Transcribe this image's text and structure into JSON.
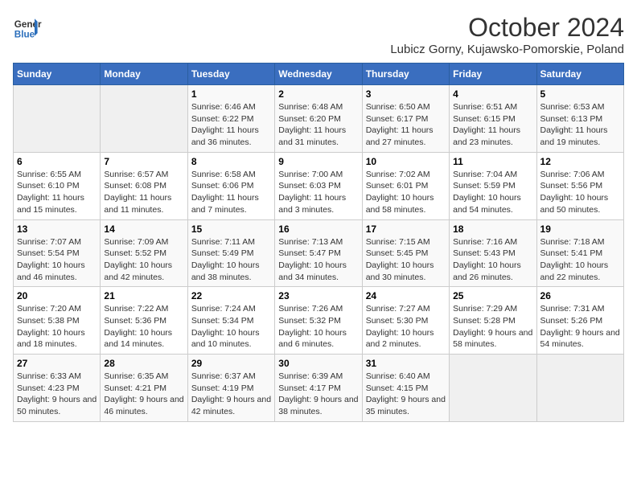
{
  "header": {
    "logo_line1": "General",
    "logo_line2": "Blue",
    "title": "October 2024",
    "subtitle": "Lubicz Gorny, Kujawsko-Pomorskie, Poland"
  },
  "days_of_week": [
    "Sunday",
    "Monday",
    "Tuesday",
    "Wednesday",
    "Thursday",
    "Friday",
    "Saturday"
  ],
  "weeks": [
    [
      {
        "day": "",
        "info": ""
      },
      {
        "day": "",
        "info": ""
      },
      {
        "day": "1",
        "info": "Sunrise: 6:46 AM\nSunset: 6:22 PM\nDaylight: 11 hours and 36 minutes."
      },
      {
        "day": "2",
        "info": "Sunrise: 6:48 AM\nSunset: 6:20 PM\nDaylight: 11 hours and 31 minutes."
      },
      {
        "day": "3",
        "info": "Sunrise: 6:50 AM\nSunset: 6:17 PM\nDaylight: 11 hours and 27 minutes."
      },
      {
        "day": "4",
        "info": "Sunrise: 6:51 AM\nSunset: 6:15 PM\nDaylight: 11 hours and 23 minutes."
      },
      {
        "day": "5",
        "info": "Sunrise: 6:53 AM\nSunset: 6:13 PM\nDaylight: 11 hours and 19 minutes."
      }
    ],
    [
      {
        "day": "6",
        "info": "Sunrise: 6:55 AM\nSunset: 6:10 PM\nDaylight: 11 hours and 15 minutes."
      },
      {
        "day": "7",
        "info": "Sunrise: 6:57 AM\nSunset: 6:08 PM\nDaylight: 11 hours and 11 minutes."
      },
      {
        "day": "8",
        "info": "Sunrise: 6:58 AM\nSunset: 6:06 PM\nDaylight: 11 hours and 7 minutes."
      },
      {
        "day": "9",
        "info": "Sunrise: 7:00 AM\nSunset: 6:03 PM\nDaylight: 11 hours and 3 minutes."
      },
      {
        "day": "10",
        "info": "Sunrise: 7:02 AM\nSunset: 6:01 PM\nDaylight: 10 hours and 58 minutes."
      },
      {
        "day": "11",
        "info": "Sunrise: 7:04 AM\nSunset: 5:59 PM\nDaylight: 10 hours and 54 minutes."
      },
      {
        "day": "12",
        "info": "Sunrise: 7:06 AM\nSunset: 5:56 PM\nDaylight: 10 hours and 50 minutes."
      }
    ],
    [
      {
        "day": "13",
        "info": "Sunrise: 7:07 AM\nSunset: 5:54 PM\nDaylight: 10 hours and 46 minutes."
      },
      {
        "day": "14",
        "info": "Sunrise: 7:09 AM\nSunset: 5:52 PM\nDaylight: 10 hours and 42 minutes."
      },
      {
        "day": "15",
        "info": "Sunrise: 7:11 AM\nSunset: 5:49 PM\nDaylight: 10 hours and 38 minutes."
      },
      {
        "day": "16",
        "info": "Sunrise: 7:13 AM\nSunset: 5:47 PM\nDaylight: 10 hours and 34 minutes."
      },
      {
        "day": "17",
        "info": "Sunrise: 7:15 AM\nSunset: 5:45 PM\nDaylight: 10 hours and 30 minutes."
      },
      {
        "day": "18",
        "info": "Sunrise: 7:16 AM\nSunset: 5:43 PM\nDaylight: 10 hours and 26 minutes."
      },
      {
        "day": "19",
        "info": "Sunrise: 7:18 AM\nSunset: 5:41 PM\nDaylight: 10 hours and 22 minutes."
      }
    ],
    [
      {
        "day": "20",
        "info": "Sunrise: 7:20 AM\nSunset: 5:38 PM\nDaylight: 10 hours and 18 minutes."
      },
      {
        "day": "21",
        "info": "Sunrise: 7:22 AM\nSunset: 5:36 PM\nDaylight: 10 hours and 14 minutes."
      },
      {
        "day": "22",
        "info": "Sunrise: 7:24 AM\nSunset: 5:34 PM\nDaylight: 10 hours and 10 minutes."
      },
      {
        "day": "23",
        "info": "Sunrise: 7:26 AM\nSunset: 5:32 PM\nDaylight: 10 hours and 6 minutes."
      },
      {
        "day": "24",
        "info": "Sunrise: 7:27 AM\nSunset: 5:30 PM\nDaylight: 10 hours and 2 minutes."
      },
      {
        "day": "25",
        "info": "Sunrise: 7:29 AM\nSunset: 5:28 PM\nDaylight: 9 hours and 58 minutes."
      },
      {
        "day": "26",
        "info": "Sunrise: 7:31 AM\nSunset: 5:26 PM\nDaylight: 9 hours and 54 minutes."
      }
    ],
    [
      {
        "day": "27",
        "info": "Sunrise: 6:33 AM\nSunset: 4:23 PM\nDaylight: 9 hours and 50 minutes."
      },
      {
        "day": "28",
        "info": "Sunrise: 6:35 AM\nSunset: 4:21 PM\nDaylight: 9 hours and 46 minutes."
      },
      {
        "day": "29",
        "info": "Sunrise: 6:37 AM\nSunset: 4:19 PM\nDaylight: 9 hours and 42 minutes."
      },
      {
        "day": "30",
        "info": "Sunrise: 6:39 AM\nSunset: 4:17 PM\nDaylight: 9 hours and 38 minutes."
      },
      {
        "day": "31",
        "info": "Sunrise: 6:40 AM\nSunset: 4:15 PM\nDaylight: 9 hours and 35 minutes."
      },
      {
        "day": "",
        "info": ""
      },
      {
        "day": "",
        "info": ""
      }
    ]
  ]
}
